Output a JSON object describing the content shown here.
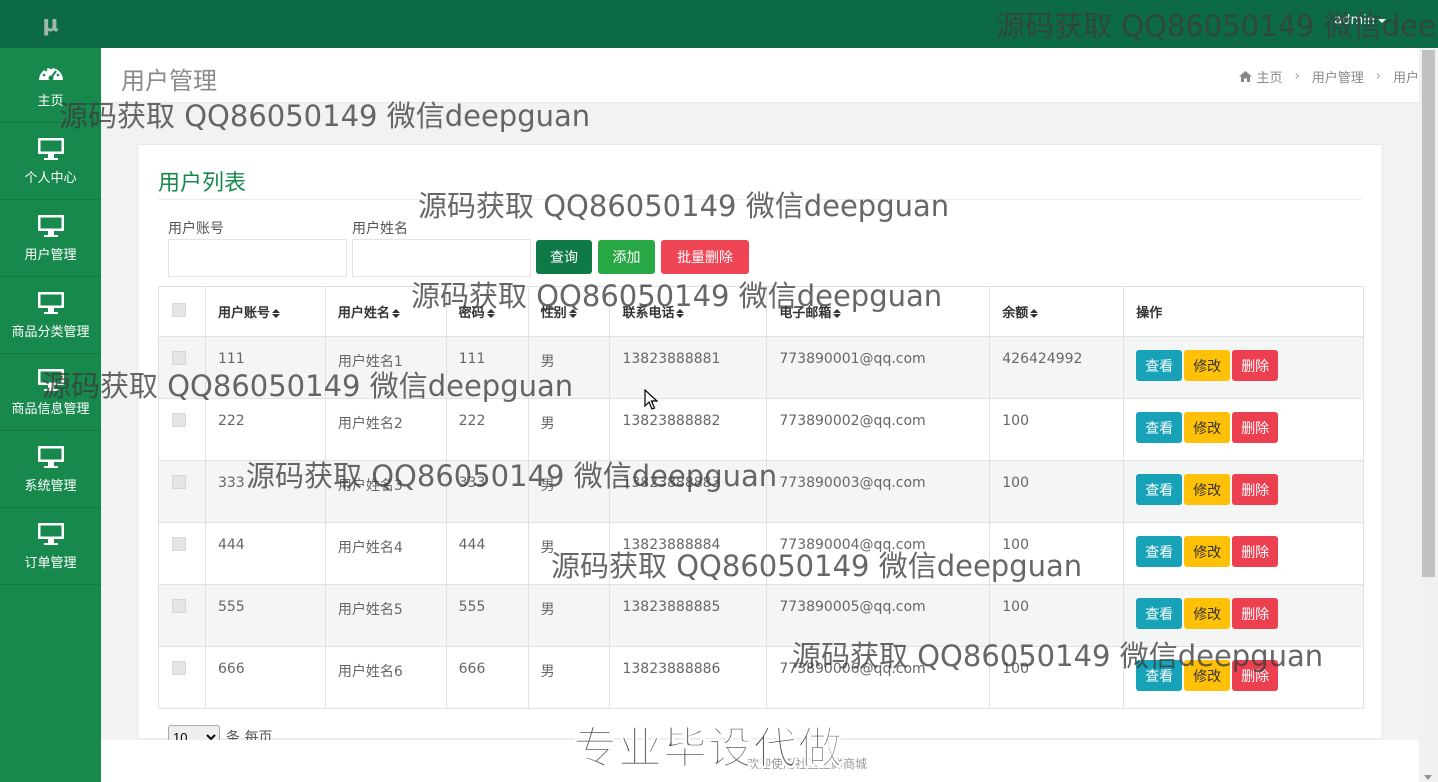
{
  "app": {
    "logo": "μ",
    "user": "admin"
  },
  "sidebar": {
    "items": [
      {
        "label": "主页",
        "icon": "dashboard-icon"
      },
      {
        "label": "个人中心",
        "icon": "monitor-icon"
      },
      {
        "label": "用户管理",
        "icon": "monitor-icon"
      },
      {
        "label": "商品分类管理",
        "icon": "monitor-icon"
      },
      {
        "label": "商品信息管理",
        "icon": "monitor-icon"
      },
      {
        "label": "系统管理",
        "icon": "monitor-icon"
      },
      {
        "label": "订单管理",
        "icon": "monitor-icon"
      }
    ]
  },
  "header": {
    "title": "用户管理",
    "breadcrumb": [
      "主页",
      "用户管理",
      "用户"
    ]
  },
  "list": {
    "title": "用户列表",
    "filters": {
      "account_label": "用户账号",
      "account_value": "",
      "name_label": "用户姓名",
      "name_value": ""
    },
    "buttons": {
      "query": "查询",
      "add": "添加",
      "batch_delete": "批量删除"
    },
    "columns": [
      "用户账号",
      "用户姓名",
      "密码",
      "性别",
      "联系电话",
      "电子邮箱",
      "余额",
      "操作"
    ],
    "rows": [
      {
        "account": "111",
        "name": "用户姓名1",
        "password": "111",
        "gender": "男",
        "phone": "13823888881",
        "email": "773890001@qq.com",
        "balance": "426424992"
      },
      {
        "account": "222",
        "name": "用户姓名2",
        "password": "222",
        "gender": "男",
        "phone": "13823888882",
        "email": "773890002@qq.com",
        "balance": "100"
      },
      {
        "account": "333",
        "name": "用户姓名3",
        "password": "333",
        "gender": "男",
        "phone": "13823888883",
        "email": "773890003@qq.com",
        "balance": "100"
      },
      {
        "account": "444",
        "name": "用户姓名4",
        "password": "444",
        "gender": "男",
        "phone": "13823888884",
        "email": "773890004@qq.com",
        "balance": "100"
      },
      {
        "account": "555",
        "name": "用户姓名5",
        "password": "555",
        "gender": "男",
        "phone": "13823888885",
        "email": "773890005@qq.com",
        "balance": "100"
      },
      {
        "account": "666",
        "name": "用户姓名6",
        "password": "666",
        "gender": "男",
        "phone": "13823888886",
        "email": "773890006@qq.com",
        "balance": "100"
      }
    ],
    "row_actions": {
      "view": "查看",
      "edit": "修改",
      "delete": "删除"
    },
    "pager": {
      "page_size": "10",
      "suffix": "条 每页"
    }
  },
  "footer": {
    "text": "欢迎使用社区生鲜商城"
  },
  "overlay": {
    "watermark": "源码获取 QQ86050149 微信deepguan",
    "watermark_top": "源码获取 QQ86050149 微信dee",
    "promo": "专业毕设代做"
  },
  "colors": {
    "sidebar": "#17894d",
    "topbar": "#0c6b46",
    "accent": "#17894d",
    "view": "#17a2b8",
    "edit": "#ffc107",
    "delete": "#ec3f50"
  }
}
